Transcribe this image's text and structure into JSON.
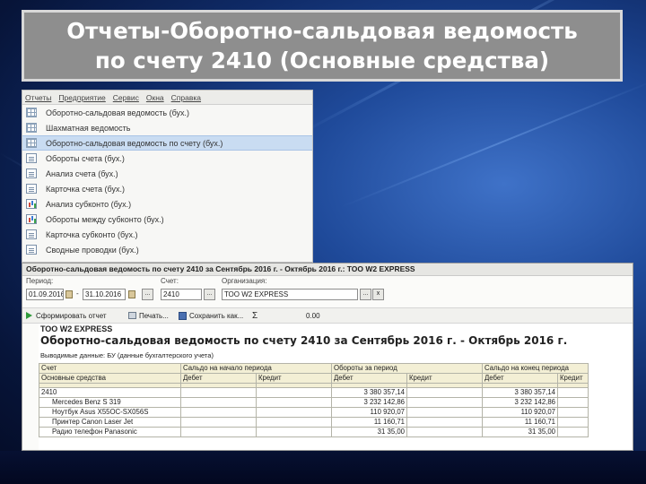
{
  "slide": {
    "title_line1": "Отчеты-Оборотно-сальдовая ведомость",
    "title_line2": "по счету 2410 (Основные средства)"
  },
  "menu": {
    "bar": [
      "Отчеты",
      "Предприятие",
      "Сервис",
      "Окна",
      "Справка"
    ],
    "items": [
      {
        "label": "Оборотно-сальдовая ведомость (бух.)",
        "icon": "table-icon",
        "selected": false
      },
      {
        "label": "Шахматная ведомость",
        "icon": "table-icon",
        "selected": false
      },
      {
        "label": "Оборотно-сальдовая ведомость по счету (бух.)",
        "icon": "table-icon",
        "selected": true
      },
      {
        "label": "Обороты счета (бух.)",
        "icon": "doc-icon",
        "selected": false
      },
      {
        "label": "Анализ счета (бух.)",
        "icon": "doc-icon",
        "selected": false
      },
      {
        "label": "Карточка счета (бух.)",
        "icon": "doc-icon",
        "selected": false
      },
      {
        "label": "Анализ субконто (бух.)",
        "icon": "chart-icon",
        "selected": false
      },
      {
        "label": "Обороты между субконто (бух.)",
        "icon": "chart-icon",
        "selected": false
      },
      {
        "label": "Карточка субконто (бух.)",
        "icon": "doc-icon",
        "selected": false
      },
      {
        "label": "Сводные проводки (бух.)",
        "icon": "doc-icon",
        "selected": false
      }
    ]
  },
  "report": {
    "window_title": "Оборотно-сальдовая ведомость по счету 2410 за Сентябрь 2016 г. - Октябрь 2016 г.: ТОО W2 EXPRESS",
    "period_label": "Период:",
    "account_label": "Счет:",
    "org_label": "Организация:",
    "date_from": "01.09.2016",
    "date_to": "31.10.2016",
    "account_value": "2410",
    "org_value": "ТОО W2 EXPRESS",
    "date_sep": "-",
    "more_btn": "...",
    "clear_btn": "x",
    "sigma": "Σ",
    "sum_value": "0.00",
    "toolbar": {
      "generate": "Сформировать отчет",
      "print": "Печать...",
      "save": "Сохранить как..."
    },
    "org_name": "ТОО W2 EXPRESS",
    "report_title": "Оборотно-сальдовая ведомость по счету 2410 за Сентябрь 2016 г. - Октябрь 2016 г.",
    "note": "Выводимые данные: БУ (данные бухгалтерского учета)",
    "table": {
      "header1": [
        "Счет",
        "Сальдо на начало периода",
        "Обороты за период",
        "Сальдо на конец периода"
      ],
      "header2": [
        "Основные средства",
        "Дебет",
        "Кредит",
        "Дебет",
        "Кредит",
        "Дебет",
        "Кредит"
      ],
      "rows": [
        [
          "2410",
          "",
          "",
          "3 380 357,14",
          "",
          "3 380 357,14",
          ""
        ],
        [
          "Mercedes Benz S 319",
          "",
          "",
          "3 232 142,86",
          "",
          "3 232 142,86",
          ""
        ],
        [
          "Ноутбук Asus X55OC-SX056S",
          "",
          "",
          "110 920,07",
          "",
          "110 920,07",
          ""
        ],
        [
          "Принтер Canon Laser Jet",
          "",
          "",
          "11 160,71",
          "",
          "11 160,71",
          ""
        ],
        [
          "Радио телефон Panasonic",
          "",
          "",
          "31 35,00",
          "",
          "31 35,00",
          ""
        ]
      ]
    }
  }
}
